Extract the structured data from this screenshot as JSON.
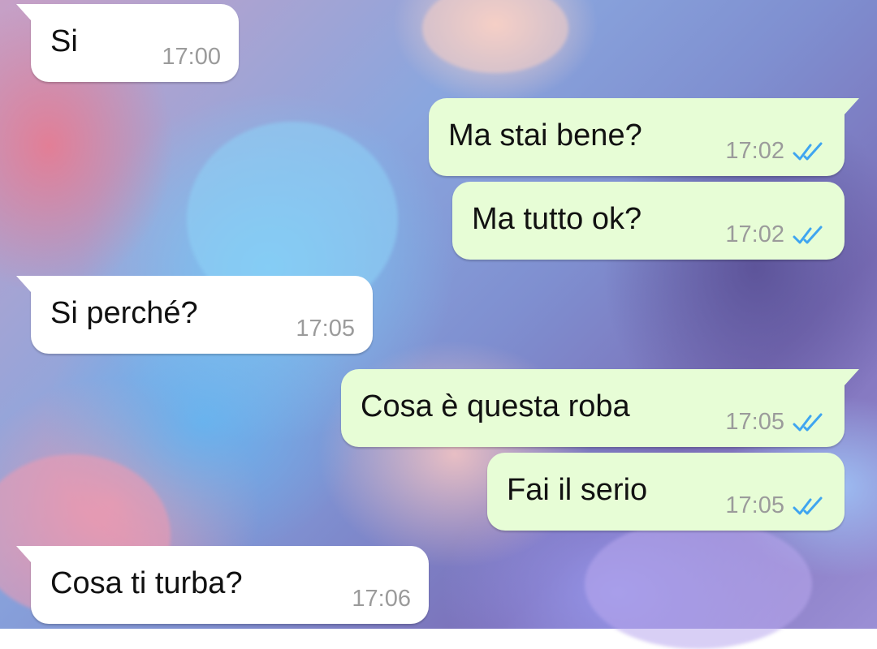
{
  "chat": {
    "colors": {
      "incoming_bubble": "#ffffff",
      "outgoing_bubble": "#e7fdd6",
      "timestamp": "#9b9b9b",
      "read_ticks": "#3fa5f0"
    },
    "messages": [
      {
        "direction": "incoming",
        "text": "Si",
        "time": "17:00"
      },
      {
        "direction": "outgoing",
        "text": "Ma stai bene?",
        "time": "17:02",
        "status": "read",
        "status_icon": "double-check-icon"
      },
      {
        "direction": "outgoing",
        "text": "Ma tutto ok?",
        "time": "17:02",
        "status": "read",
        "status_icon": "double-check-icon"
      },
      {
        "direction": "incoming",
        "text": "Si perché?",
        "time": "17:05"
      },
      {
        "direction": "outgoing",
        "text": "Cosa è questa roba",
        "time": "17:05",
        "status": "read",
        "status_icon": "double-check-icon"
      },
      {
        "direction": "outgoing",
        "text": "Fai il serio",
        "time": "17:05",
        "status": "read",
        "status_icon": "double-check-icon"
      },
      {
        "direction": "incoming",
        "text": "Cosa ti turba?",
        "time": "17:06"
      }
    ]
  }
}
